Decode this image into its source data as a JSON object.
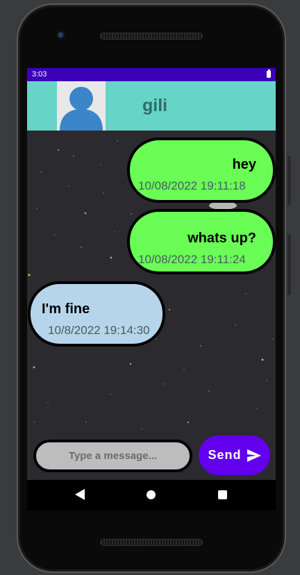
{
  "status_bar": {
    "time": "3:03",
    "battery_icon": "battery-full-icon"
  },
  "header": {
    "contact_name": "gili",
    "avatar_icon": "person-avatar-icon",
    "background": "#67d4c8"
  },
  "messages": [
    {
      "direction": "sent",
      "text": "hey",
      "timestamp": "10/08/2022 19:11:18"
    },
    {
      "direction": "sent",
      "text": "whats up?",
      "timestamp": "10/08/2022 19:11:24"
    },
    {
      "direction": "received",
      "text": "I'm fine",
      "timestamp": "10/8/2022 19:14:30"
    }
  ],
  "composer": {
    "placeholder": "Type a message...",
    "value": "",
    "send_label": "Send",
    "send_icon": "send-arrow-icon"
  },
  "nav_bar": {
    "back_icon": "back-triangle-icon",
    "home_icon": "home-circle-icon",
    "recents_icon": "recents-square-icon"
  },
  "colors": {
    "status_bar": "#3c00b8",
    "sent_bubble": "#69fd55",
    "received_bubble": "#b6d5ea",
    "send_button": "#6200ee"
  }
}
